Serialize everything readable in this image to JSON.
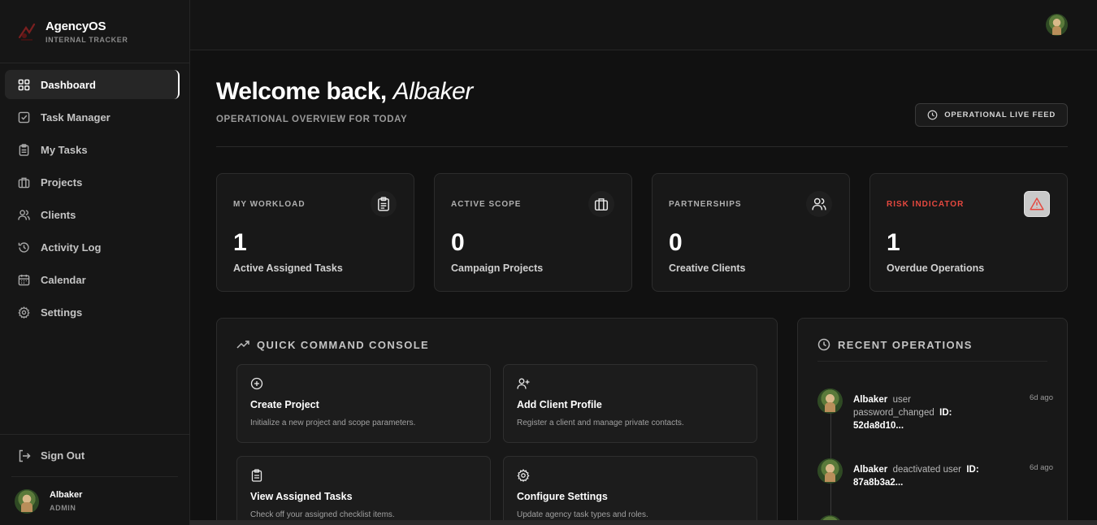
{
  "brand": {
    "title": "AgencyOS",
    "subtitle": "INTERNAL TRACKER"
  },
  "nav": [
    {
      "label": "Dashboard",
      "icon": "grid-icon",
      "active": true
    },
    {
      "label": "Task Manager",
      "icon": "checkbox-icon"
    },
    {
      "label": "My Tasks",
      "icon": "clipboard-icon"
    },
    {
      "label": "Projects",
      "icon": "briefcase-icon"
    },
    {
      "label": "Clients",
      "icon": "users-icon"
    },
    {
      "label": "Activity Log",
      "icon": "history-icon"
    },
    {
      "label": "Calendar",
      "icon": "calendar-icon"
    },
    {
      "label": "Settings",
      "icon": "gear-icon"
    }
  ],
  "sidebar_bottom": {
    "signout_label": "Sign Out",
    "user_name": "Albaker",
    "user_role": "ADMIN"
  },
  "header": {
    "welcome": "Welcome back,",
    "name": "Albaker",
    "overview": "OPERATIONAL OVERVIEW FOR TODAY",
    "live_feed_label": "OPERATIONAL LIVE FEED"
  },
  "stats": [
    {
      "title": "MY WORKLOAD",
      "value": "1",
      "sub": "Active Assigned Tasks",
      "icon": "clipboard-icon"
    },
    {
      "title": "ACTIVE SCOPE",
      "value": "0",
      "sub": "Campaign Projects",
      "icon": "briefcase-icon"
    },
    {
      "title": "PARTNERSHIPS",
      "value": "0",
      "sub": "Creative Clients",
      "icon": "users-icon"
    },
    {
      "title": "RISK INDICATOR",
      "value": "1",
      "sub": "Overdue Operations",
      "icon": "warning-icon",
      "color": "#e5483f"
    }
  ],
  "console": {
    "title": "QUICK COMMAND CONSOLE",
    "actions": [
      {
        "title": "Create Project",
        "desc": "Initialize a new project and scope parameters.",
        "icon": "plus-circle-icon"
      },
      {
        "title": "Add Client Profile",
        "desc": "Register a client and manage private contacts.",
        "icon": "user-plus-icon"
      },
      {
        "title": "View Assigned Tasks",
        "desc": "Check off your assigned checklist items.",
        "icon": "clipboard-icon"
      },
      {
        "title": "Configure Settings",
        "desc": "Update agency task types and roles.",
        "icon": "gear-icon"
      }
    ]
  },
  "recent": {
    "title": "RECENT OPERATIONS",
    "items": [
      {
        "user": "Albaker",
        "action": "user",
        "detail": "password_changed",
        "id_label": "ID:",
        "id": "52da8d10...",
        "time": "6d ago"
      },
      {
        "user": "Albaker",
        "action": "deactivated user",
        "id_label": "ID:",
        "id": "87a8b3a2...",
        "time": "6d ago"
      }
    ]
  }
}
